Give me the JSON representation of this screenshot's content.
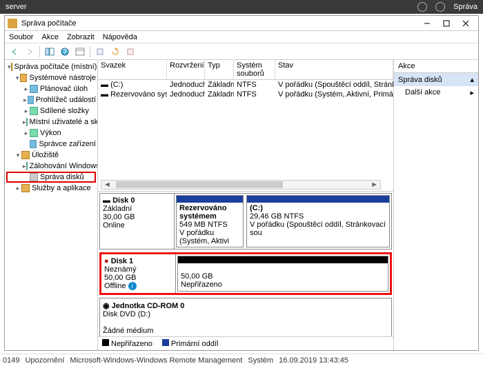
{
  "server_bar": {
    "left_text": "server",
    "right_label": "Správa"
  },
  "window": {
    "title": "Správa počítače",
    "menu": [
      "Soubor",
      "Akce",
      "Zobrazit",
      "Nápověda"
    ]
  },
  "tree": {
    "root": "Správa počítače (místní)",
    "sys_tools": "Systémové nástroje",
    "sys_children": [
      "Plánovač úloh",
      "Prohlížeč událostí",
      "Sdílené složky",
      "Místní uživatelé a skupi",
      "Výkon",
      "Správce zařízení"
    ],
    "storage": "Úložiště",
    "storage_children": [
      "Zálohování Windows Se",
      "Správa disků"
    ],
    "services": "Služby a aplikace"
  },
  "volumes": {
    "headers": [
      "Svazek",
      "Rozvržení",
      "Typ",
      "Systém souborů",
      "Stav"
    ],
    "rows": [
      {
        "name": "(C:)",
        "layout": "Jednoduchý",
        "type": "Základní",
        "fs": "NTFS",
        "status": "V pořádku (Spouštěcí oddíl, Stránkovací"
      },
      {
        "name": "Rezervováno systémem",
        "layout": "Jednoduchý",
        "type": "Základní",
        "fs": "NTFS",
        "status": "V pořádku (Systém, Aktivní, Primární od"
      }
    ]
  },
  "disks": {
    "d0": {
      "title": "Disk 0",
      "kind": "Základní",
      "size": "30,00 GB",
      "state": "Online",
      "p1": {
        "name": "Rezervováno systémem",
        "size": "549 MB NTFS",
        "status": "V pořádku (Systém, Aktivi"
      },
      "p2": {
        "name": "(C:)",
        "size": "29,46 GB NTFS",
        "status": "V pořádku (Spouštěcí oddíl, Stránkovací sou"
      }
    },
    "d1": {
      "title": "Disk 1",
      "kind": "Neznámý",
      "size": "50,00 GB",
      "state": "Offline",
      "p1": {
        "size": "50,00 GB",
        "status": "Nepřiřazeno"
      }
    },
    "cd": {
      "title": "Jednotka CD-ROM 0",
      "line2": "Disk DVD (D:)",
      "line3": "Žádné médium"
    }
  },
  "legend": {
    "l1": "Nepřiřazeno",
    "l2": "Primární oddíl"
  },
  "actions": {
    "header": "Akce",
    "selected": "Správa disků",
    "more": "Další akce"
  },
  "statusbar": {
    "code": "0149",
    "level": "Upozornění",
    "source": "Microsoft-Windows-Windows Remote Management",
    "cat": "Systém",
    "time": "16.09.2019 13:43:45"
  }
}
